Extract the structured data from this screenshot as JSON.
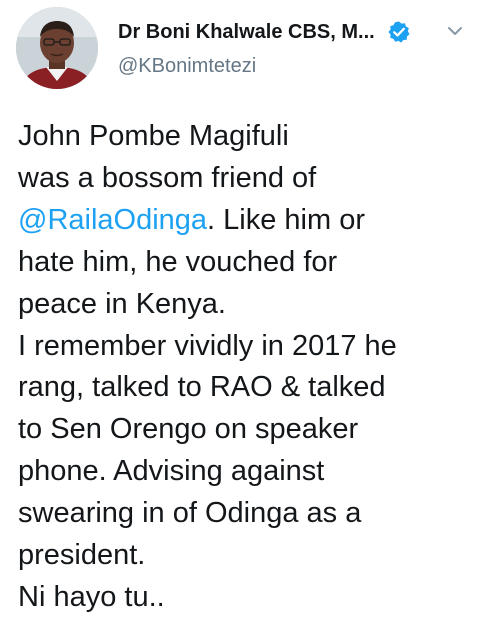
{
  "author": {
    "display_name": "Dr Boni Khalwale CBS, M...",
    "handle": "@KBonimtetezi",
    "verified": true,
    "avatar_icon": "avatar-photo",
    "verified_icon": "verified-badge-icon",
    "menu_icon": "chevron-down-icon"
  },
  "tweet": {
    "lines": [
      {
        "text": "John Pombe Magifuli"
      },
      {
        "text": "was a bossom friend of"
      },
      {
        "mention": "@RailaOdinga",
        "text": ". Like him or"
      },
      {
        "text": "hate him, he vouched for"
      },
      {
        "text": "peace in Kenya."
      },
      {
        "text": "I remember vividly in 2017 he"
      },
      {
        "text": "rang, talked to RAO & talked"
      },
      {
        "text": "to Sen Orengo on speaker"
      },
      {
        "text": "phone. Advising against"
      },
      {
        "text": "swearing in of Odinga as a"
      },
      {
        "text": "president."
      },
      {
        "text": "Ni hayo tu.."
      }
    ]
  },
  "colors": {
    "text": "#14171a",
    "secondary_text": "#657786",
    "link": "#1da1f2",
    "verified": "#1da1f2",
    "background": "#ffffff"
  }
}
